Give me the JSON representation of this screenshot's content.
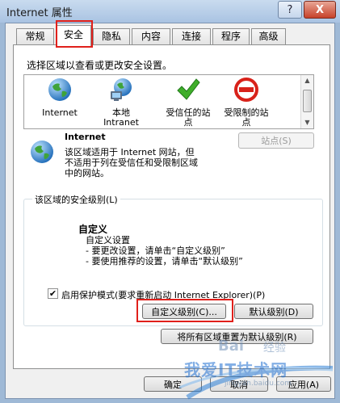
{
  "window": {
    "title": "Internet 属性",
    "help_label": "?",
    "close_label": "X"
  },
  "tabs": [
    "常规",
    "安全",
    "隐私",
    "内容",
    "连接",
    "程序",
    "高级"
  ],
  "instruction": "选择区域以查看或更改安全设置。",
  "zones": [
    {
      "label": "Internet",
      "icon": "globe-icon"
    },
    {
      "label": "本地\nIntranet",
      "icon": "intranet-icon"
    },
    {
      "label": "受信任的站\n点",
      "icon": "check-icon"
    },
    {
      "label": "受限制的站\n点",
      "icon": "prohibited-icon"
    }
  ],
  "selected_zone": {
    "name": "Internet",
    "description": "该区域适用于 Internet 网站，但\n不适用于列在受信任和受限制区域\n中的网站。"
  },
  "sites_button": "站点(S)",
  "security_level": {
    "group_label": "该区域的安全级别(L)",
    "heading": "自定义",
    "lines": [
      "自定义设置",
      "- 要更改设置，请单击“自定义级别”",
      "- 要使用推荐的设置，请单击“默认级别”"
    ]
  },
  "protected_mode": {
    "label": "启用保护模式(要求重新启动 Internet Explorer)(P)",
    "checked": true
  },
  "buttons": {
    "custom_level": "自定义级别(C)...",
    "default_level": "默认级别(D)",
    "reset_all": "将所有区域重置为默认级别(R)",
    "ok": "确定",
    "cancel": "取消",
    "apply": "应用(A)"
  },
  "watermark": {
    "line1": "Bai",
    "line2": "经验",
    "line3": "我爱IT技术网",
    "line4": "jingyan.baidu.com"
  },
  "colors": {
    "highlight": "#e0201b",
    "frame": "#a9c3e2"
  }
}
